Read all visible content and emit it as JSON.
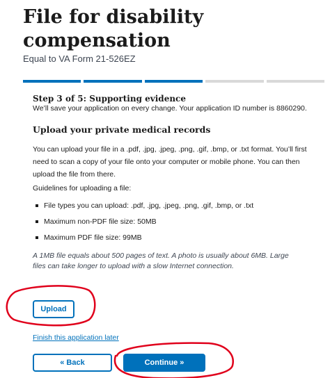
{
  "header": {
    "title": "File for disability compensation",
    "subtitle": "Equal to VA Form 21-526EZ"
  },
  "progress": {
    "current_step": 3,
    "total_steps": 5
  },
  "step": {
    "title": "Step 3 of 5: Supporting evidence",
    "save_note": "We’ll save your application on every change. Your application ID number is 8860290."
  },
  "section": {
    "title": "Upload your private medical records",
    "intro": "You can upload your file in a .pdf, .jpg, .jpeg, .png, .gif, .bmp, or .txt format. You’ll first need to scan a copy of your file onto your computer or mobile phone. You can then upload the file from there.",
    "guidelines_label": "Guidelines for uploading a file:",
    "guidelines": [
      "File types you can upload: .pdf, .jpg, .jpeg, .png, .gif, .bmp, or .txt",
      "Maximum non-PDF file size: 50MB",
      "Maximum PDF file size: 99MB"
    ],
    "note": "A 1MB file equals about 500 pages of text. A photo is usually about 6MB. Large files can take longer to upload with a slow Internet connection."
  },
  "actions": {
    "upload_label": "Upload",
    "finish_later_label": "Finish this application later",
    "back_label": "« Back",
    "continue_label": "Continue »"
  },
  "colors": {
    "primary": "#0071bb",
    "progress_inactive": "#d9d9d9",
    "annotation": "#e0001b"
  }
}
